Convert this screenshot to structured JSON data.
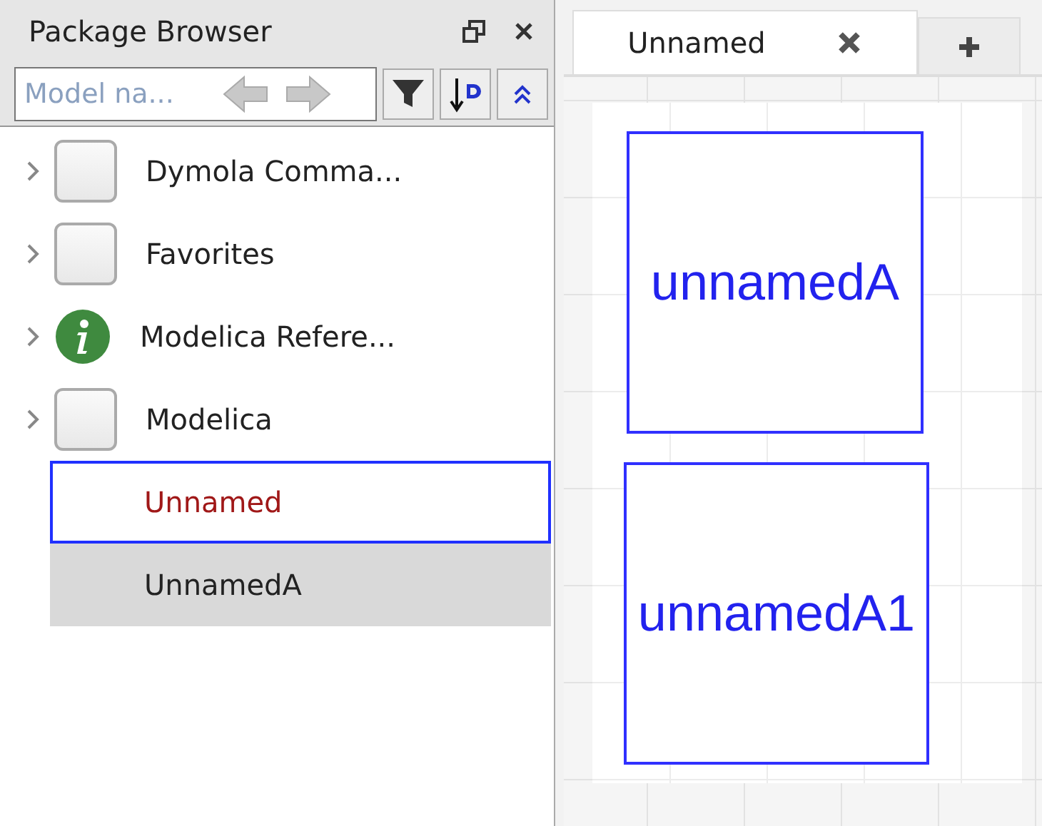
{
  "panel": {
    "title": "Package Browser",
    "search": {
      "placeholder": "Model na..."
    }
  },
  "tree": [
    {
      "label": "Dymola Comma...",
      "kind": "folder",
      "has_children": true,
      "selected": false,
      "focused": false,
      "modified": false
    },
    {
      "label": "Favorites",
      "kind": "folder",
      "has_children": true,
      "selected": false,
      "focused": false,
      "modified": false
    },
    {
      "label": "Modelica Refere...",
      "kind": "info",
      "has_children": true,
      "selected": false,
      "focused": false,
      "modified": false
    },
    {
      "label": "Modelica",
      "kind": "folder",
      "has_children": true,
      "selected": false,
      "focused": false,
      "modified": false
    },
    {
      "label": "Unnamed",
      "kind": "plain",
      "has_children": false,
      "selected": false,
      "focused": true,
      "modified": true
    },
    {
      "label": "UnnamedA",
      "kind": "plain",
      "has_children": false,
      "selected": true,
      "focused": false,
      "modified": false
    }
  ],
  "tabs": [
    {
      "label": "Unnamed",
      "selected": true
    }
  ],
  "components": [
    {
      "label": "unnamedA"
    },
    {
      "label": "unnamedA1"
    }
  ]
}
